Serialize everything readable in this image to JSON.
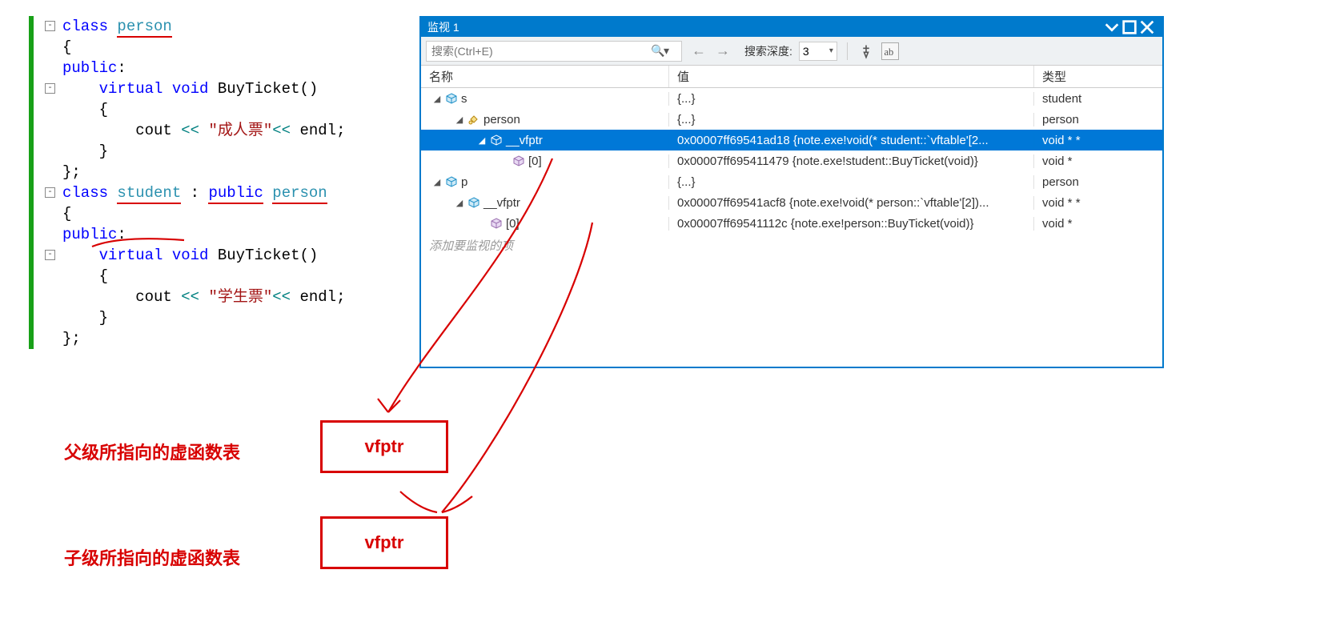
{
  "code": {
    "lines": [
      {
        "fold": "-",
        "html": "<span class='kw'>class</span> <span class='type ul-person'>person</span>"
      },
      {
        "html": "{"
      },
      {
        "html": "<span class='kw'>public</span>:"
      },
      {
        "fold": "-",
        "html": "    <span class='kw'>virtual</span> <span class='kw'>void</span> BuyTicket()"
      },
      {
        "html": "    {"
      },
      {
        "html": "        cout <span class='op'>&lt;&lt;</span> <span class='str'>\"成人票\"</span><span class='op'>&lt;&lt;</span> endl;"
      },
      {
        "html": "    }"
      },
      {
        "html": "};"
      },
      {
        "html": ""
      },
      {
        "fold": "-",
        "html": "<span class='kw'>class</span> <span class='type ul-student'>student</span> : <span class='kw ul-student'>public</span> <span class='type ul-student'>person</span>"
      },
      {
        "html": "{"
      },
      {
        "html": "<span class='kw'>public</span>:"
      },
      {
        "fold": "-",
        "html": "    <span class='kw'>virtual</span> <span class='kw'>void</span> BuyTicket()"
      },
      {
        "html": "    {"
      },
      {
        "html": "        cout <span class='op'>&lt;&lt;</span> <span class='str'>\"学生票\"</span><span class='op'>&lt;&lt;</span> endl;"
      },
      {
        "html": "    }"
      },
      {
        "html": "};"
      }
    ]
  },
  "watch": {
    "title": "监视 1",
    "search_placeholder": "搜索(Ctrl+E)",
    "depth_label": "搜索深度:",
    "depth_value": "3",
    "columns": {
      "name": "名称",
      "value": "值",
      "type": "类型"
    },
    "rows": [
      {
        "depth": 0,
        "expand": "down",
        "icon": "obj",
        "name": "s",
        "value": "{...}",
        "type": "student",
        "sel": false
      },
      {
        "depth": 1,
        "expand": "down",
        "icon": "base",
        "name": "person",
        "value": "{...}",
        "type": "person",
        "sel": false
      },
      {
        "depth": 2,
        "expand": "down",
        "icon": "obj",
        "name": "__vfptr",
        "value": "0x00007ff69541ad18 {note.exe!void(* student::`vftable'[2...",
        "type": "void * *",
        "sel": true
      },
      {
        "depth": 3,
        "expand": "none",
        "icon": "elem",
        "name": "[0]",
        "value": "0x00007ff695411479 {note.exe!student::BuyTicket(void)}",
        "type": "void *",
        "sel": false
      },
      {
        "depth": 0,
        "expand": "down",
        "icon": "obj",
        "name": "p",
        "value": "{...}",
        "type": "person",
        "sel": false
      },
      {
        "depth": 1,
        "expand": "down",
        "icon": "obj",
        "name": "__vfptr",
        "value": "0x00007ff69541acf8 {note.exe!void(* person::`vftable'[2])...",
        "type": "void * *",
        "sel": false
      },
      {
        "depth": 2,
        "expand": "none",
        "icon": "elem",
        "name": "[0]",
        "value": "0x00007ff69541112c {note.exe!person::BuyTicket(void)}",
        "type": "void *",
        "sel": false
      }
    ],
    "add_placeholder": "添加要监视的项"
  },
  "annotations": {
    "box1_text": "vfptr",
    "box2_text": "vfptr",
    "label1": "父级所指向的虚函数表",
    "label2": "子级所指向的虚函数表"
  }
}
